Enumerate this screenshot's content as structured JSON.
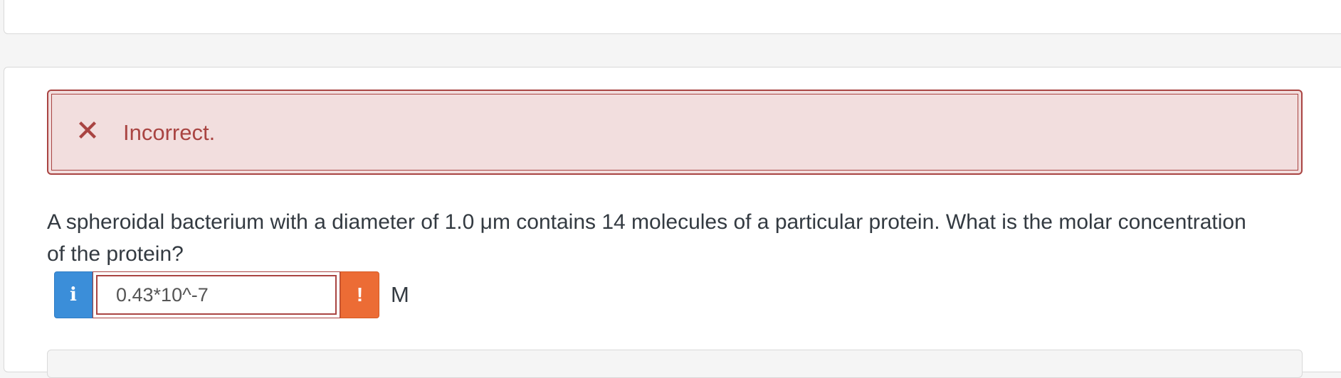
{
  "feedback": {
    "status_icon": "x-mark-icon",
    "status_color": "#a94442",
    "message": "Incorrect."
  },
  "question": {
    "text": "A spheroidal bacterium with a diameter of 1.0 μm contains 14 molecules of a particular protein. What is the molar concentration of the protein?"
  },
  "answer": {
    "info_label": "i",
    "value": "0.43*10^-7",
    "warning_label": "!",
    "unit": "M"
  },
  "colors": {
    "alert_background": "#f2dede",
    "alert_border": "#a94442",
    "info_button": "#3b8ed9",
    "warning_button": "#ec6c35"
  }
}
